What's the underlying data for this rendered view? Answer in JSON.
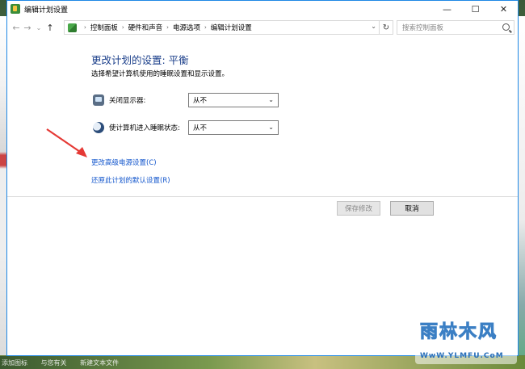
{
  "window": {
    "title": "编辑计划设置",
    "controls": {
      "minimize": "—",
      "maximize": "☐",
      "close": "✕"
    }
  },
  "nav": {
    "back": "←",
    "forward": "→",
    "dropdown": "⌄",
    "up": "↑"
  },
  "breadcrumb": {
    "separator": "›",
    "items": [
      "控制面板",
      "硬件和声音",
      "电源选项",
      "编辑计划设置"
    ]
  },
  "search": {
    "placeholder": "搜索控制面板"
  },
  "main": {
    "heading": "更改计划的设置: 平衡",
    "subtext": "选择希望计算机使用的睡眠设置和显示设置。",
    "display_off": {
      "label": "关闭显示器:",
      "value": "从不"
    },
    "sleep": {
      "label": "使计算机进入睡眠状态:",
      "value": "从不"
    },
    "links": {
      "advanced": "更改高级电源设置(C)",
      "restore": "还原此计划的默认设置(R)"
    },
    "buttons": {
      "save": "保存修改",
      "cancel": "取消"
    }
  },
  "watermark": {
    "logo": "雨林木风",
    "url": "WwW.YLMFU.CoM"
  },
  "taskbar": {
    "items": [
      "添加图标",
      "与您有关",
      "新建文本文件"
    ]
  },
  "colors": {
    "heading": "#1a3e8a",
    "link": "#1155cc",
    "arrow": "#e53935"
  }
}
